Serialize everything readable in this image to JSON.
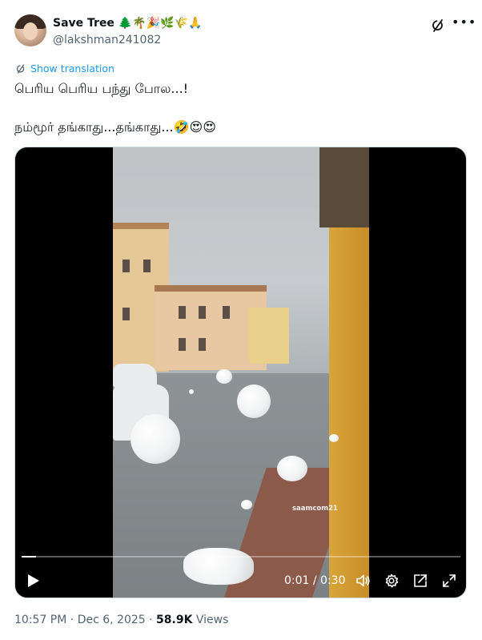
{
  "author": {
    "name": "Save Tree 🌲🌴🎉🌿🌾🙏",
    "handle": "@lakshman241082"
  },
  "translate_label": "Show translation",
  "tweet": {
    "line1": "பெரிய பெரிய பந்து போல...!",
    "line2": "நம்மூர் தங்காது...தங்காது...🤣😍😍"
  },
  "video": {
    "watermark": "saamcom21",
    "time_display": "0:01 / 0:30",
    "progress_fraction": 0.033
  },
  "meta": {
    "time": "10:57 PM",
    "separator": " · ",
    "date": "Dec 6, 2025",
    "views_count": "58.9K",
    "views_label": " Views"
  },
  "icons": {
    "more": "more-horizontal-icon",
    "grok": "grok-icon",
    "translate": "translate-icon",
    "play": "play-icon",
    "volume": "volume-icon",
    "settings": "settings-gear-icon",
    "popout": "popout-icon",
    "fullscreen": "fullscreen-icon"
  },
  "colors": {
    "link": "#1d9bf0",
    "secondary_text": "#536471",
    "primary_text": "#0f1419"
  }
}
